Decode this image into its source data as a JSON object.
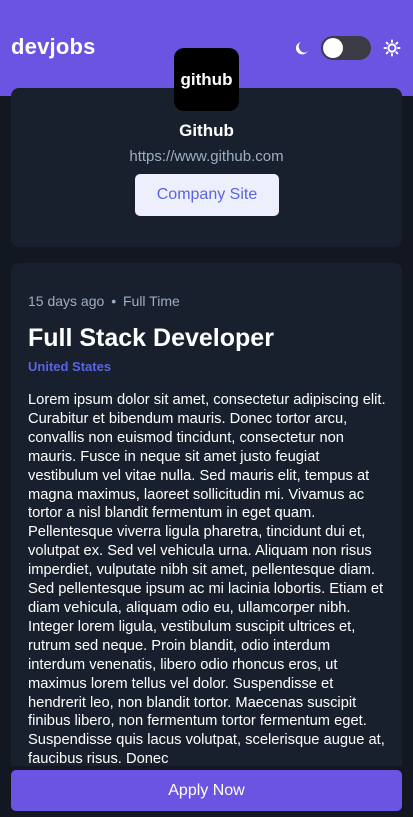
{
  "header": {
    "brand": "devjobs",
    "theme": {
      "moon_icon": "moon-icon",
      "sun_icon": "sun-icon",
      "dark_mode": false
    }
  },
  "company": {
    "logo_text": "github",
    "name": "Github",
    "url": "https://www.github.com",
    "site_button": "Company Site"
  },
  "job": {
    "posted": "15 days ago",
    "separator": "•",
    "contract": "Full Time",
    "title": "Full Stack Developer",
    "location": "United States",
    "description": "Lorem ipsum dolor sit amet, consectetur adipiscing elit. Curabitur et bibendum mauris. Donec tortor arcu, convallis non euismod tincidunt, consectetur non mauris. Fusce in neque sit amet justo feugiat vestibulum vel vitae nulla. Sed mauris elit, tempus at magna maximus, laoreet sollicitudin mi. Vivamus ac tortor a nisl blandit fermentum in eget quam. Pellentesque viverra ligula pharetra, tincidunt dui et, volutpat ex. Sed vel vehicula urna. Aliquam non risus imperdiet, vulputate nibh sit amet, pellentesque diam. Sed pellentesque ipsum ac mi lacinia lobortis. Etiam et diam vehicula, aliquam odio eu, ullamcorper nibh. Integer lorem ligula, vestibulum suscipit ultrices et, rutrum sed neque. Proin blandit, odio interdum interdum venenatis, libero odio rhoncus eros, ut maximus lorem tellus vel dolor. Suspendisse et hendrerit leo, non blandit tortor. Maecenas suscipit finibus libero, non fermentum tortor fermentum eget. Suspendisse quis lacus volutpat, scelerisque augue at, faucibus risus. Donec"
  },
  "footer": {
    "apply_label": "Apply Now"
  },
  "colors": {
    "accent": "#6b54e2",
    "background": "#121721",
    "card": "#19202d",
    "muted_text": "#9daec2",
    "link": "#5964e0",
    "site_button_bg": "#eeeffc"
  }
}
